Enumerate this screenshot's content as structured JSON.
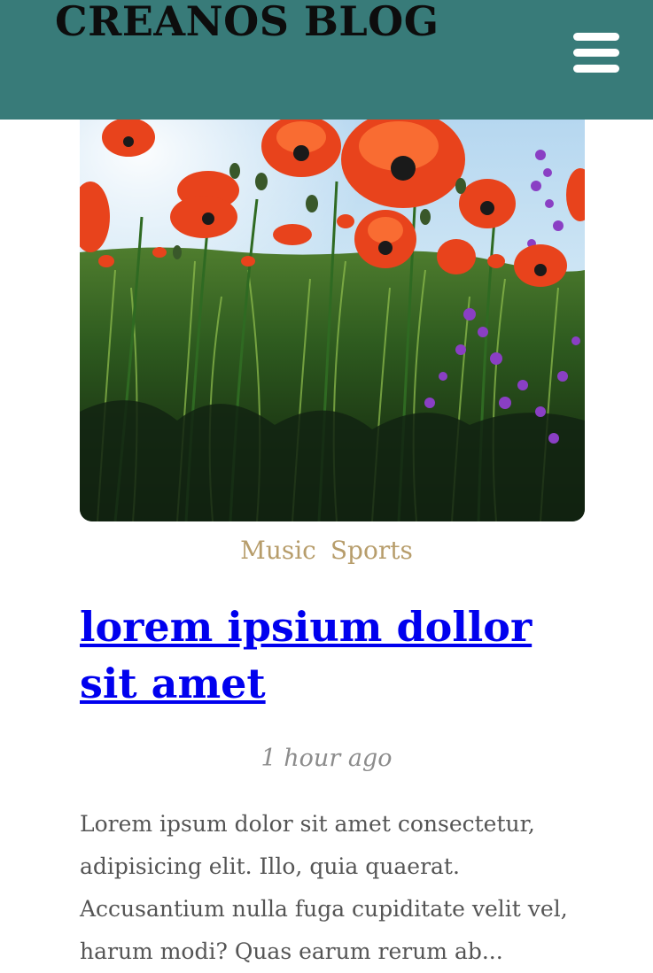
{
  "header": {
    "site_title": "CREANOS BLOG",
    "background_color": "#387b79",
    "menu_icon": "hamburger-menu-icon"
  },
  "post": {
    "image_alt": "Red poppies and purple wildflowers in a sunlit field",
    "categories": [
      "Music",
      "Sports"
    ],
    "title": "lorem ipsium dollor sit amet",
    "time_ago": "1 hour ago",
    "excerpt": "Lorem ipsum dolor sit amet consectetur, adipisicing elit. Illo, quia quaerat. Accusantium nulla fuga cupiditate velit vel, harum modi? Quas earum rerum ab..."
  },
  "colors": {
    "category": "#b79d6b",
    "link": "#0000ee",
    "timestamp": "#8c8c8c",
    "body_text": "#555555"
  }
}
